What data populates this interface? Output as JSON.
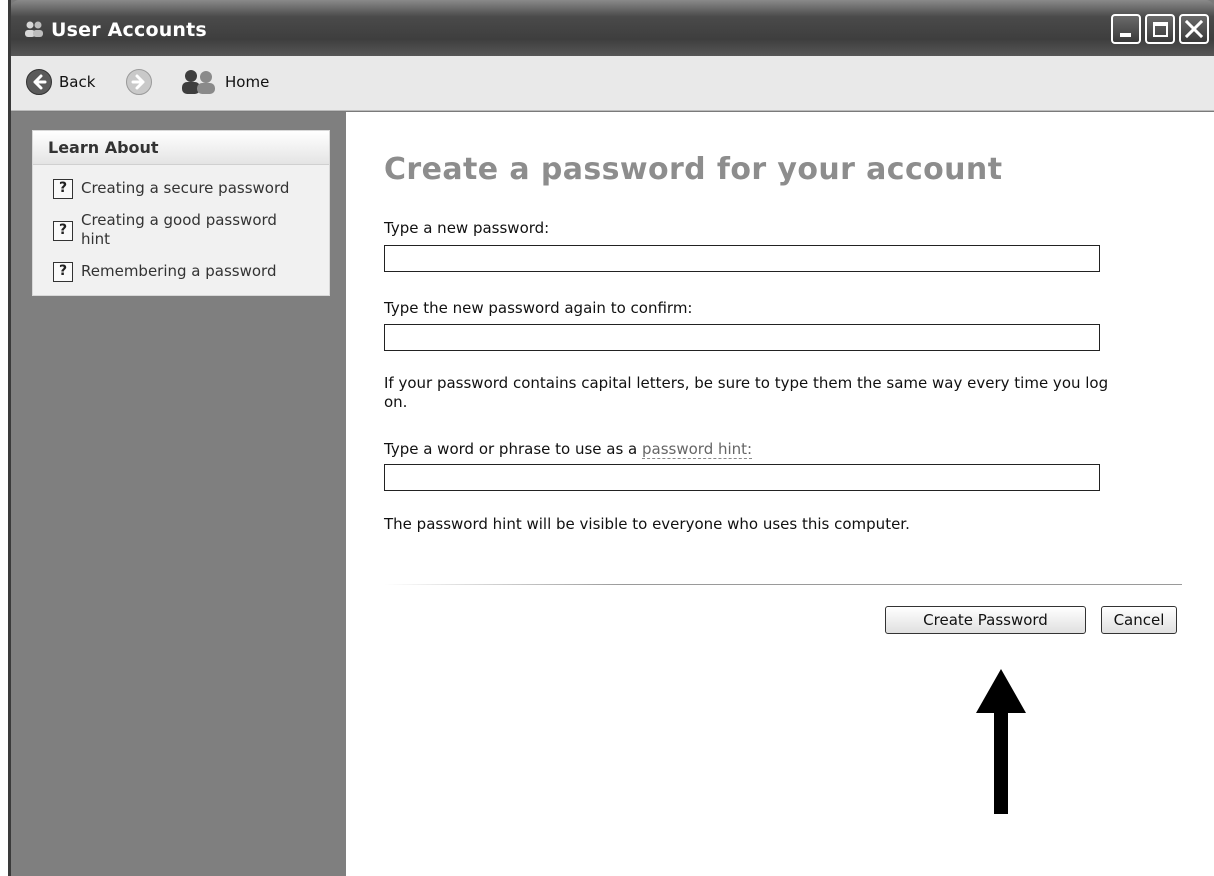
{
  "window": {
    "title": "User Accounts",
    "icons": {
      "app": "user-accounts-icon",
      "minimize": "minimize-icon",
      "maximize": "maximize-icon",
      "close": "close-icon"
    }
  },
  "toolbar": {
    "back_label": "Back",
    "home_label": "Home",
    "icons": {
      "back": "back-arrow-icon",
      "forward": "forward-arrow-icon",
      "home": "users-home-icon"
    }
  },
  "learn_about": {
    "title": "Learn About",
    "items": [
      {
        "label": "Creating a secure password",
        "icon": "help-icon"
      },
      {
        "label": "Creating a good password hint",
        "icon": "help-icon"
      },
      {
        "label": "Remembering a password",
        "icon": "help-icon"
      }
    ]
  },
  "main": {
    "heading": "Create a password for your account",
    "new_password_label": "Type a new password:",
    "new_password_value": "",
    "confirm_label": "Type the new password again to confirm:",
    "confirm_value": "",
    "caps_note": "If your password contains capital letters, be sure to type them the same way every time you log on.",
    "hint_label_prefix": "Type a word or phrase to use as a ",
    "hint_label_link": "password hint:",
    "hint_value": "",
    "hint_note": "The password hint will be visible to everyone who uses this computer.",
    "create_button": "Create Password",
    "cancel_button": "Cancel"
  },
  "annotation": {
    "icon": "up-arrow-icon"
  }
}
